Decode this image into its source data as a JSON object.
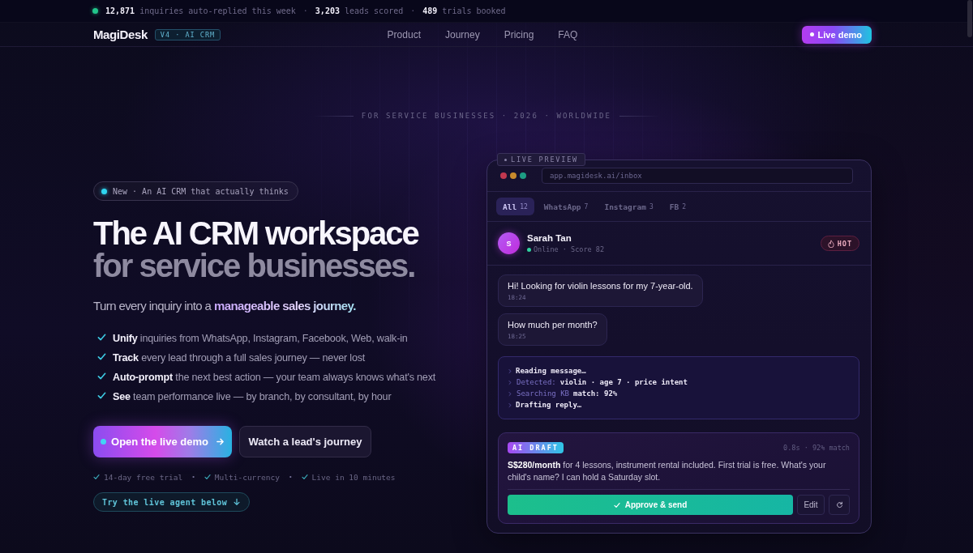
{
  "ticker": {
    "items": [
      {
        "kind": "stat",
        "text": "**12,871** inquiries auto-replied this week"
      },
      {
        "kind": "separator",
        "text": "·"
      },
      {
        "kind": "stat",
        "text": "**3,203** leads scored"
      },
      {
        "kind": "separator",
        "text": "·"
      },
      {
        "kind": "stat",
        "text": "**489** trials booked"
      }
    ]
  },
  "nav": {
    "logo": "MagiDesk",
    "version_badge": "V4 · AI CRM",
    "links": [
      "Product",
      "Journey",
      "Pricing",
      "FAQ"
    ],
    "cta": "Live demo"
  },
  "tagline": "FOR SERVICE BUSINESSES · 2026 · WORLDWIDE",
  "hero": {
    "badge": "New · An AI CRM that actually thinks",
    "headline": [
      "The AI CRM workspace",
      "for service businesses."
    ],
    "subtitle": "Turn every inquiry into a **manageable sales journey.**",
    "features": [
      "**Unify** inquiries from WhatsApp, Instagram, Facebook, Web, walk-in",
      "**Track** every lead through a full sales journey — never lost",
      "**Auto-prompt** the next best action — your team always knows what's next",
      "**See** team performance live — by branch, by consultant, by hour"
    ],
    "buttons": [
      {
        "kind": "primary",
        "label": "Open the live demo"
      },
      {
        "kind": "secondary",
        "label": "Watch a lead's journey"
      }
    ],
    "perks": [
      {
        "kind": "perk",
        "text": "14-day free trial"
      },
      {
        "kind": "separator",
        "text": "·"
      },
      {
        "kind": "perk",
        "text": "Multi-currency"
      },
      {
        "kind": "separator",
        "text": "·"
      },
      {
        "kind": "perk",
        "text": "Live in 10 minutes"
      }
    ],
    "scroll_hint": "Try the live agent below"
  },
  "preview": {
    "tag": "LIVE PREVIEW",
    "url": "app.magidesk.ai/inbox",
    "tabs": [
      {
        "label": "All",
        "count": "12",
        "selected": true
      },
      {
        "label": "WhatsApp",
        "count": "7",
        "selected": false
      },
      {
        "label": "Instagram",
        "count": "3",
        "selected": false
      },
      {
        "label": "FB",
        "count": "2",
        "selected": false
      }
    ],
    "contact": {
      "initial": "S",
      "name": "Sarah Tan",
      "online": true,
      "status": "Online · Score 82",
      "badge": "HOT"
    },
    "messages": [
      {
        "text": "Hi! Looking for violin lessons for my 7-year-old.",
        "time": "18:24"
      },
      {
        "text": "How much per month?",
        "time": "18:25"
      }
    ],
    "agent_log": [
      {
        "text": "Reading message…"
      },
      {
        "label": "Detected:",
        "text": "violin · age 7 · price intent"
      },
      {
        "label": "Searching KB",
        "text": "match: 92%"
      },
      {
        "text": "Drafting reply…"
      }
    ],
    "draft": {
      "badge": "AI DRAFT",
      "meta": "0.8s · 92% match",
      "text": "**S$280/month** for 4 lessons, instrument rental included. First trial is free. What's your child's name? I can hold a Saturday slot.",
      "actions": [
        {
          "kind": "approve",
          "label": "Approve & send"
        },
        {
          "kind": "edit",
          "label": "Edit"
        },
        {
          "kind": "regenerate"
        }
      ]
    }
  }
}
